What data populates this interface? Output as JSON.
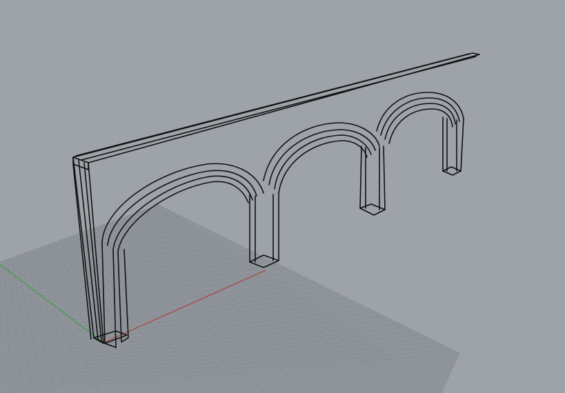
{
  "viewport": {
    "background": "#9ea2a9",
    "grid_color": "#8f949b",
    "grid_line_color": "#858a91",
    "x_axis_color": "#b0403c",
    "y_axis_color": "#3f9a48",
    "wire_color": "#101010"
  },
  "model": {
    "object": "arched-frame-wireframe",
    "arch_count": 3
  }
}
